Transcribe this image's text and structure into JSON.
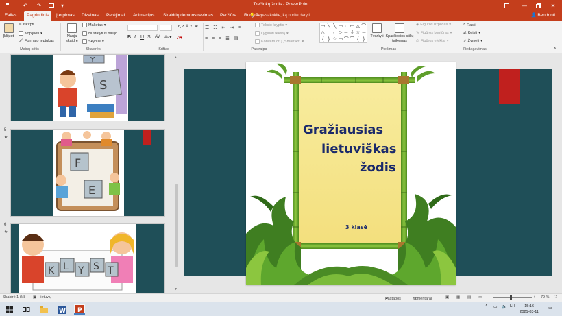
{
  "window": {
    "title": "Trečiokų žodis - PowerPoint",
    "qa_icons": [
      "save-icon",
      "undo-icon",
      "redo-icon",
      "present-from-start-icon",
      "customize-qa-icon"
    ],
    "controls": [
      "ribbon-display-icon",
      "minimize-icon",
      "restore-icon",
      "close-icon"
    ]
  },
  "tabs": [
    "Failas",
    "Pagrindinis",
    "Įterpimas",
    "Dizainas",
    "Perėjimai",
    "Animacijos",
    "Skaidrių demonstravimas",
    "Peržiūra",
    "Rodymas"
  ],
  "active_tab": "Pagrindinis",
  "tell_me": "Papasakokite, ką norite daryti...",
  "share": "Bendrinti",
  "ribbon": {
    "clipboard": {
      "paste": "Įklijuoti",
      "cut": "Iškirpti",
      "copy": "Kopijuoti",
      "format_painter": "Formato teptukas",
      "label": "Mainų sritis"
    },
    "slides": {
      "new_slide_1": "Nauja",
      "new_slide_2": "skaidrė",
      "layout": "Maketas",
      "reset": "Nustatyti iš naujo",
      "section": "Skyrius",
      "label": "Skaidrės"
    },
    "font": {
      "bold": "B",
      "italic": "I",
      "underline": "U",
      "strike": "S",
      "grow": "A",
      "shrink": "A",
      "label": "Šriftas"
    },
    "paragraph": {
      "text_direction": "Teksto kryptis",
      "align_text": "Lygiuoti tekstą",
      "smartart": "Konvertuoti į „SmartArt“",
      "label": "Pastraipa"
    },
    "drawing": {
      "shape_glyphs": [
        "▭",
        "╲",
        "╲",
        "▭",
        "○",
        "▭",
        "△",
        "⌒",
        "△",
        "⌐",
        "⌐",
        "▷",
        "⇨",
        "⇩",
        "☆",
        "⇦",
        "{",
        "}",
        "☆",
        "▭",
        "⌒",
        "⌒",
        "{",
        "}"
      ],
      "arrange": "Tvarkyti",
      "quick_styles_1": "Sparčiosios stilių",
      "quick_styles_2": "taikymas",
      "fill": "Figūros užpildas",
      "outline": "Figūros kontūras",
      "effects": "Figūros efektai",
      "label": "Piešimas"
    },
    "editing": {
      "find": "Rasti",
      "replace": "Keisti",
      "select": "Žymėti",
      "label": "Redagavimas"
    }
  },
  "thumbnails": [
    {
      "number": "",
      "star": ""
    },
    {
      "number": "5",
      "star": "★"
    },
    {
      "number": "6",
      "star": "★"
    }
  ],
  "slide": {
    "title_line1": "Gražiausias",
    "title_line2": "lietuviškas",
    "title_line3": "žodis",
    "subtitle": "3 klasė"
  },
  "status": {
    "slide_count": "Skaidrė 1 iš 8",
    "language": "lietuvių",
    "notes": "Pastabos",
    "comments": "Komentarai",
    "zoom": "79 %"
  },
  "taskbar": {
    "apps": [
      "windows-start-icon",
      "task-view-icon",
      "file-explorer-icon",
      "word-icon",
      "powerpoint-icon"
    ],
    "language": "LIT",
    "time": "15:16",
    "date": "2021-03-11"
  },
  "colors": {
    "accent": "#c43e1c",
    "slide_title": "#1b2a6b",
    "bamboo": "#6aa72d",
    "parchment": "#f6e79a",
    "stage_bg": "#1f4f58",
    "red_tab": "#c0201e"
  }
}
